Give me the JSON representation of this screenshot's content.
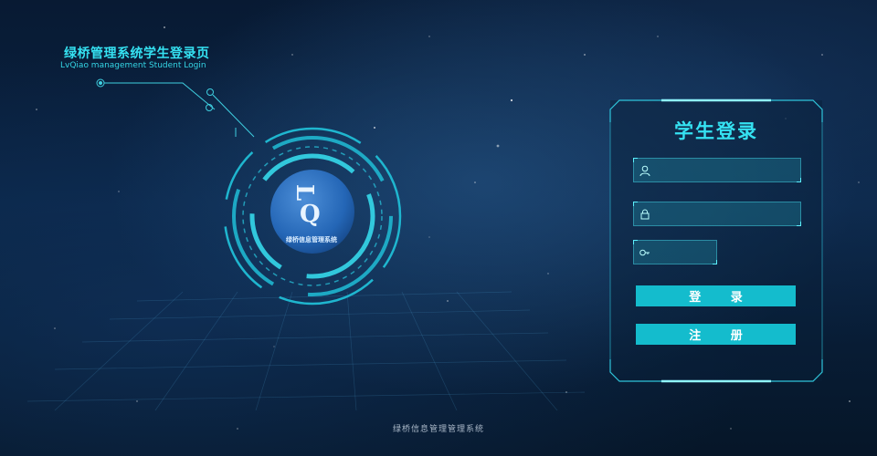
{
  "header": {
    "title": "绿桥管理系统学生登录页",
    "subtitle": "LvQiao management Student Login"
  },
  "logo": {
    "letters": [
      "L",
      "Q"
    ],
    "caption": "绿桥信息管理系统"
  },
  "login": {
    "heading": "学生登录",
    "username": {
      "value": "",
      "placeholder": "",
      "icon": "user-icon"
    },
    "password": {
      "value": "",
      "placeholder": "",
      "icon": "lock-icon"
    },
    "captcha": {
      "value": "",
      "placeholder": "",
      "icon": "key-icon"
    },
    "login_button": "登 录",
    "register_button": "注 册"
  },
  "footer": {
    "text": "绿桥信息管理管理系统"
  },
  "colors": {
    "accent": "#35e2f2",
    "button": "#14bccd",
    "background": "#0a2444"
  }
}
